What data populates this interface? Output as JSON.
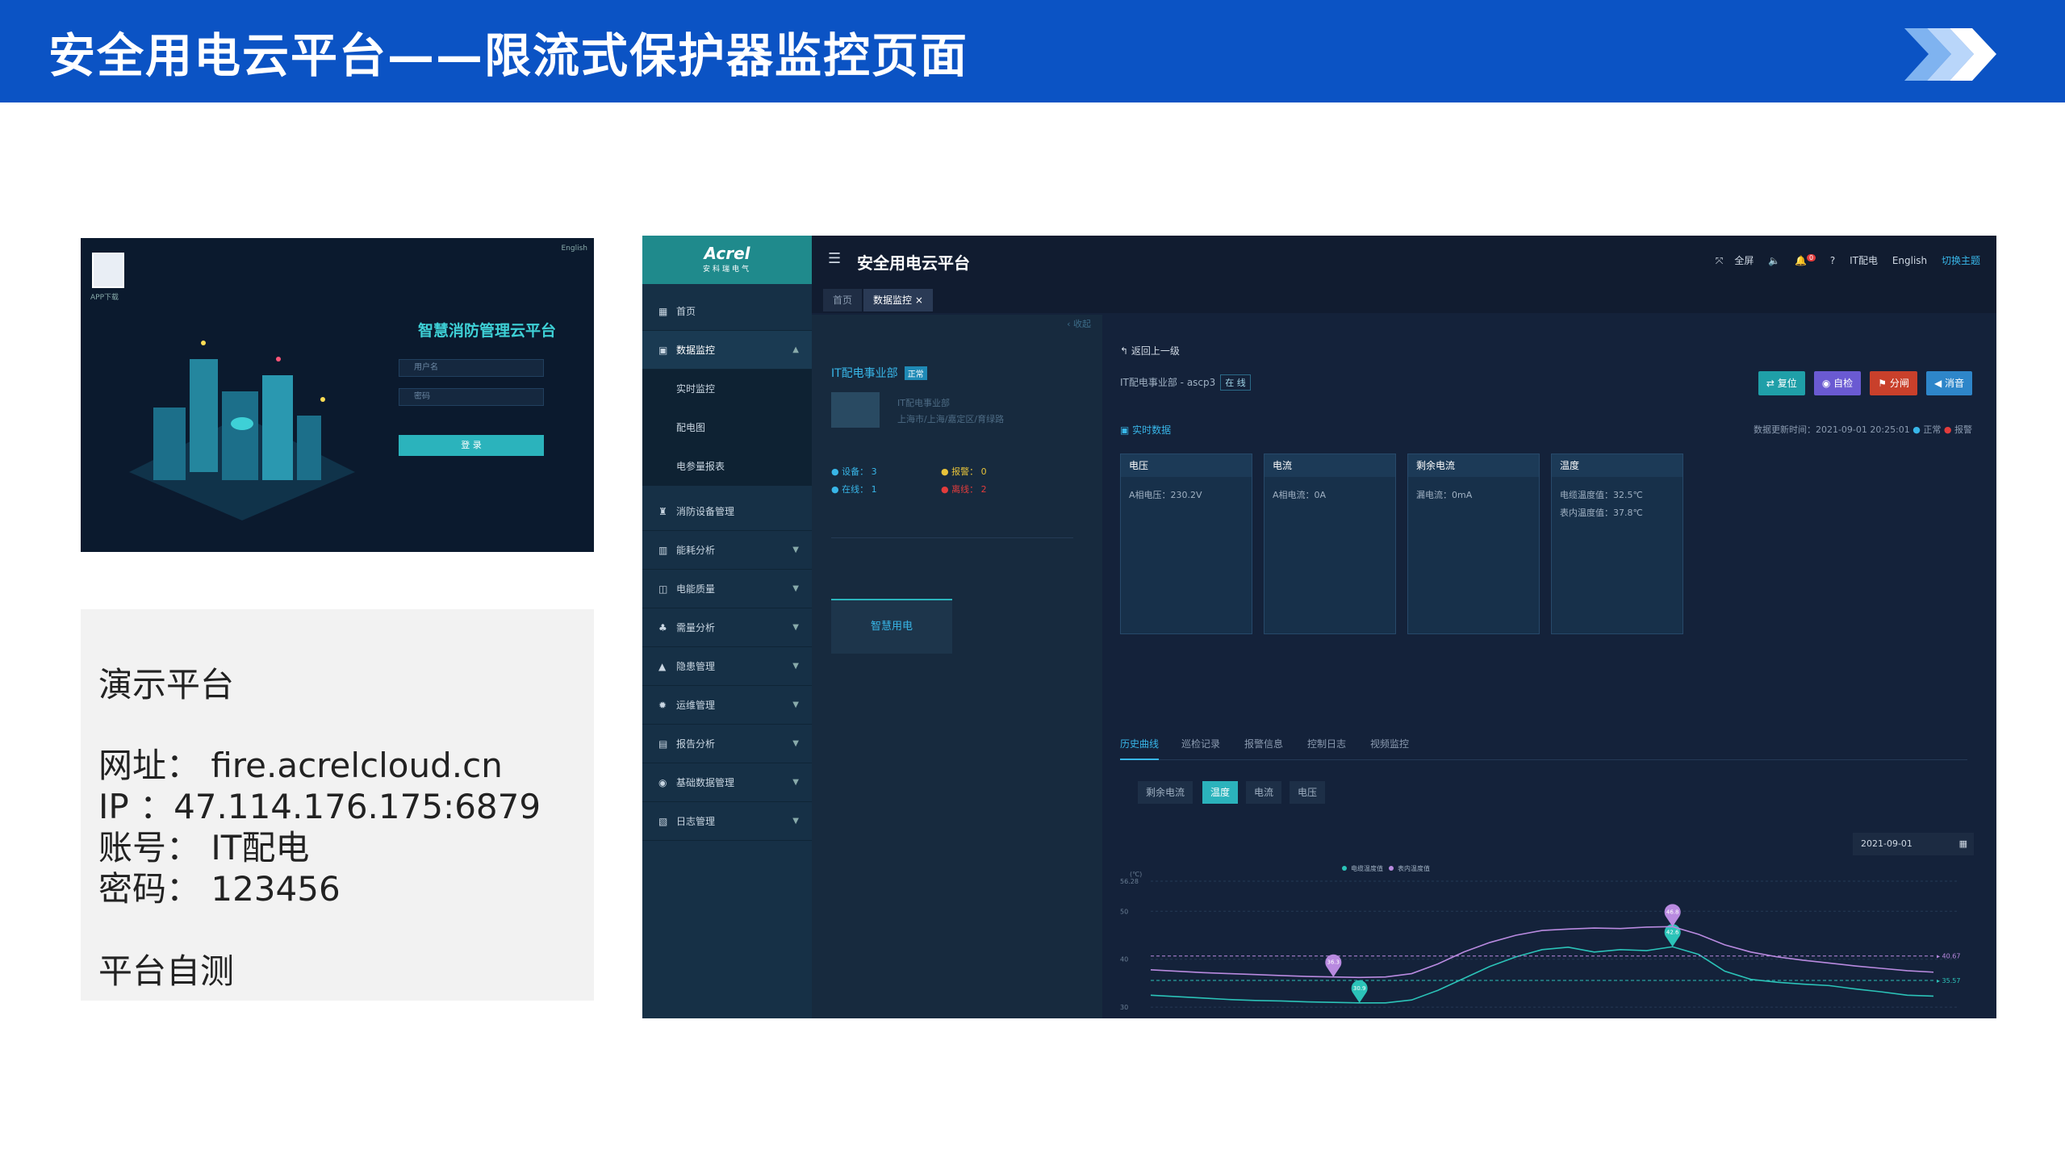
{
  "slide": {
    "title": "安全用电云平台——限流式保护器监控页面"
  },
  "login": {
    "qr_caption": "APP下载",
    "lang": "English",
    "title": "智慧消防管理云平台",
    "username_placeholder": "用户名",
    "password_placeholder": "密码",
    "login_button": "登 录"
  },
  "info": {
    "heading": "演示平台",
    "url": "网址：  fire.acrelcloud.cn",
    "ip": "  IP  ：47.114.176.175:6879",
    "account": "账号：  IT配电",
    "password": "密码：  123456",
    "footer": "平台自测"
  },
  "app": {
    "logo": {
      "brand": "Acrel",
      "sub": "安科瑞电气"
    },
    "header": {
      "title": "安全用电云平台",
      "fullscreen": "全屏",
      "bell_count": "0",
      "user": "IT配电",
      "language": "English",
      "theme": "切换主题"
    },
    "tabs": [
      {
        "label": "首页"
      },
      {
        "label": "数据监控 ×"
      }
    ],
    "sidebar": {
      "items": [
        {
          "label": "首页",
          "icon": "grid-icon"
        },
        {
          "label": "数据监控",
          "icon": "monitor-icon"
        },
        {
          "label": "实时监控"
        },
        {
          "label": "配电图"
        },
        {
          "label": "电参量报表"
        },
        {
          "label": "消防设备管理",
          "icon": "extinguisher-icon"
        },
        {
          "label": "能耗分析",
          "icon": "bar-icon"
        },
        {
          "label": "电能质量",
          "icon": "quality-icon"
        },
        {
          "label": "需量分析",
          "icon": "demand-icon"
        },
        {
          "label": "隐患管理",
          "icon": "warning-icon"
        },
        {
          "label": "运维管理",
          "icon": "gear-icon"
        },
        {
          "label": "报告分析",
          "icon": "report-icon"
        },
        {
          "label": "基础数据管理",
          "icon": "database-icon"
        },
        {
          "label": "日志管理",
          "icon": "log-icon"
        }
      ]
    },
    "left_panel": {
      "collapse": "收起",
      "org_name": "IT配电事业部",
      "org_badge": "正常",
      "org_sub_name": "IT配电事业部",
      "org_address": "上海市/上海/嘉定区/育绿路",
      "devices": "设备：  3",
      "alarms": "报警：  0",
      "online": "在线：  1",
      "offline": "离线：  2",
      "node_label": "智慧用电"
    },
    "detail": {
      "back": "返回上一级",
      "path": "IT配电事业部 - ascp3",
      "online": "在 线",
      "buttons": [
        {
          "label": "复位",
          "color": "#1f9fa8"
        },
        {
          "label": "自检",
          "color": "#6a5ad2"
        },
        {
          "label": "分闸",
          "color": "#c9402b"
        },
        {
          "label": "消音",
          "color": "#2e86c9"
        }
      ],
      "realtime_title": "实时数据",
      "update_time": "数据更新时间：2021-09-01 20:25:01",
      "legend_normal": "正常",
      "legend_alarm": "报警",
      "cards": [
        {
          "title": "电压",
          "lines": [
            "A相电压：230.2V"
          ]
        },
        {
          "title": "电流",
          "lines": [
            "A相电流：0A"
          ]
        },
        {
          "title": "剩余电流",
          "lines": [
            "漏电流：0mA"
          ]
        },
        {
          "title": "温度",
          "lines": [
            "电缆温度值：32.5℃",
            "表内温度值：37.8℃"
          ]
        }
      ],
      "subtabs": [
        "历史曲线",
        "巡检记录",
        "报警信息",
        "控制日志",
        "视频监控"
      ],
      "segments": [
        "剩余电流",
        "温度",
        "电流",
        "电压"
      ],
      "date": "2021-09-01"
    }
  },
  "chart_data": {
    "type": "line",
    "ylabel": "(℃)",
    "yticks": [
      "56.28",
      "50",
      "40",
      "30"
    ],
    "ylim": [
      28,
      56.28
    ],
    "series": [
      {
        "name": "电缆温度值",
        "color": "#2bc3b8",
        "values": [
          32.5,
          32.2,
          31.9,
          31.6,
          31.4,
          31.3,
          31.1,
          31.0,
          30.9,
          30.9,
          31.5,
          33.5,
          36,
          38.5,
          40.5,
          42,
          42.5,
          41.5,
          42,
          41.8,
          42.6,
          41,
          37.5,
          35.8,
          35.2,
          34.8,
          34.5,
          33.8,
          33.2,
          32.5,
          32.3
        ],
        "max": "42.6",
        "min": "30.9",
        "avg": "35.57"
      },
      {
        "name": "表内温度值",
        "color": "#b98ae0",
        "values": [
          37.8,
          37.5,
          37.2,
          37.0,
          36.8,
          36.6,
          36.4,
          36.3,
          36.2,
          36.3,
          37,
          39,
          41.5,
          43.5,
          45,
          46,
          46.3,
          46.5,
          46.4,
          46.7,
          46.8,
          45.2,
          43,
          41.5,
          40.5,
          39.8,
          39.2,
          38.6,
          38.1,
          37.6,
          37.3
        ],
        "max": "46.8",
        "min": "36.3",
        "avg": "40.67"
      }
    ]
  }
}
